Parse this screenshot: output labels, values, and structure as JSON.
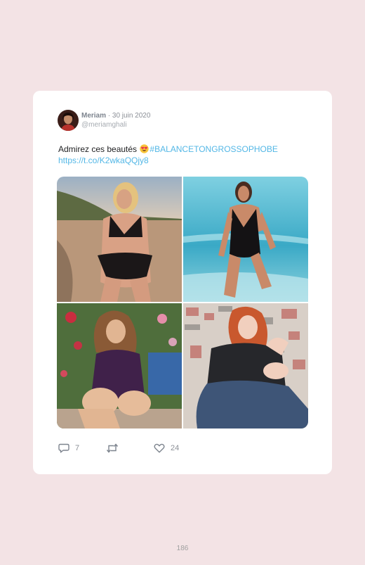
{
  "tweet": {
    "author": "Meriam",
    "separator": " · ",
    "date": "30 juin 2020",
    "handle": "@meriamghali",
    "text": "Admirez ces beautés ",
    "emoji": "heart-eyes-emoji",
    "hashtag": "#BALANCETONGROSSOPHOBE",
    "link": "https://t.co/K2wkaQQjy8",
    "photos": [
      {
        "icon": "photo-beach-woman-black-bikini"
      },
      {
        "icon": "photo-sea-woman-black-swimsuit"
      },
      {
        "icon": "photo-garden-woman-purple-top"
      },
      {
        "icon": "photo-seated-woman-jeans"
      }
    ],
    "actions": {
      "reply_count": "7",
      "retweet_count": "",
      "like_count": "24"
    }
  },
  "colors": {
    "page_background": "#f3e3e5",
    "card": "#ffffff",
    "link": "#53b7e6"
  },
  "page_number": "186"
}
